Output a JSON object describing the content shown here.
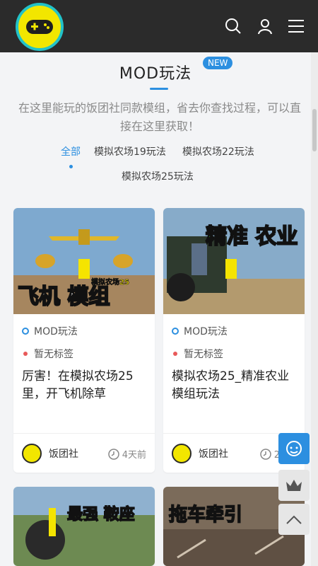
{
  "header": {
    "logo_icon": "gamepad-icon",
    "search_icon": "search-icon",
    "user_icon": "user-icon",
    "menu_icon": "menu-icon"
  },
  "section": {
    "title": "MOD玩法",
    "badge": "NEW",
    "description": "在这里能玩的饭团社同款模组，省去你查找过程，可以直接在这里获取！"
  },
  "tabs": [
    {
      "label": "全部",
      "active": true
    },
    {
      "label": "模拟农场19玩法",
      "active": false
    },
    {
      "label": "模拟农场22玩法",
      "active": false
    },
    {
      "label": "模拟农场25玩法",
      "active": false
    }
  ],
  "cards": [
    {
      "thumb_text": "飞机 模组",
      "thumb_small": "模拟农场25",
      "category": "MOD玩法",
      "tag": "暂无标签",
      "title": "厉害！在模拟农场25里，开飞机除草",
      "author": "饭团社",
      "time": "4天前"
    },
    {
      "thumb_text": "精准 农业",
      "category": "MOD玩法",
      "tag": "暂无标签",
      "title": "模拟农场25_精准农业模组玩法",
      "author": "饭团社",
      "time": "2小"
    },
    {
      "thumb_text": "最强 鞍座",
      "category": "",
      "tag": "",
      "title": "",
      "author": "",
      "time": ""
    },
    {
      "thumb_text": "拖车牵引",
      "category": "",
      "tag": "",
      "title": "",
      "author": "",
      "time": ""
    }
  ],
  "floating": {
    "support_icon": "headset-icon",
    "vip_icon": "crown-icon",
    "top_icon": "chevron-up-icon"
  },
  "colors": {
    "accent": "#2c8fe0",
    "topbar": "#2b2b2b",
    "tag_dot": "#e85a5a"
  }
}
